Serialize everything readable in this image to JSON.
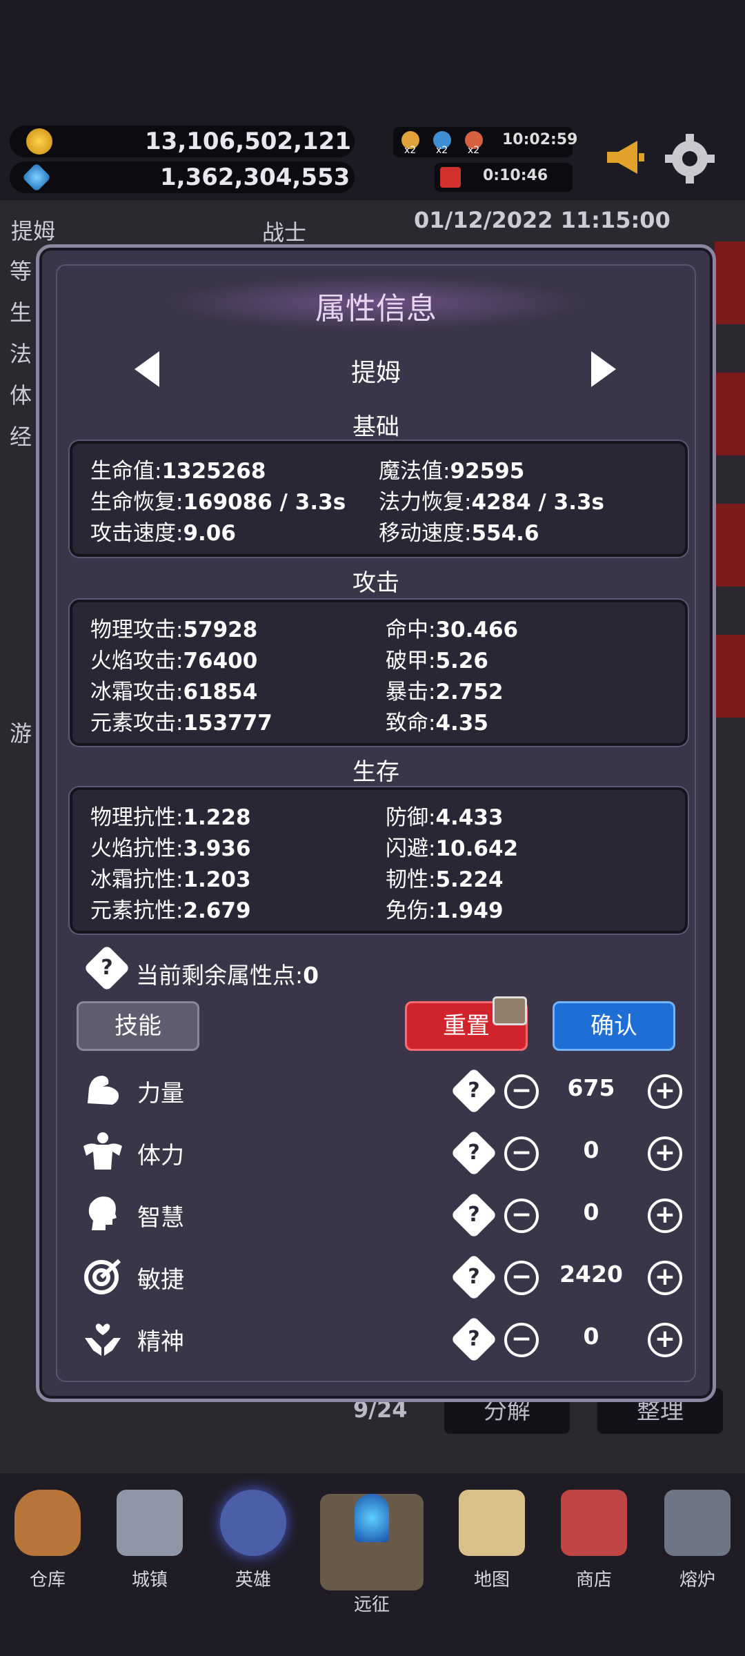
{
  "top": {
    "gold": "13,106,502,121",
    "gems": "1,362,304,553",
    "buff_multipliers": [
      "x2",
      "x2",
      "x2"
    ],
    "buff_timer": "10:02:59",
    "gift_timer": "0:10:46"
  },
  "background": {
    "hero_name": "提姆",
    "hero_class": "战士",
    "datetime": "01/12/2022 11:15:00",
    "side_labels": [
      "等",
      "生",
      "法",
      "体",
      "经",
      "游"
    ],
    "bag_count": "9/24",
    "decompose_label": "分解",
    "sort_label": "整理"
  },
  "modal": {
    "title": "属性信息",
    "hero_name": "提姆",
    "basic": {
      "label": "基础",
      "rows": [
        {
          "l_label": "生命值:",
          "l_val": "1325268",
          "r_label": "魔法值:",
          "r_val": "92595"
        },
        {
          "l_label": "生命恢复:",
          "l_val": "169086 / 3.3s",
          "r_label": "法力恢复:",
          "r_val": "4284 / 3.3s"
        },
        {
          "l_label": "攻击速度:",
          "l_val": "9.06",
          "r_label": "移动速度:",
          "r_val": "554.6"
        }
      ]
    },
    "attack": {
      "label": "攻击",
      "rows": [
        {
          "l_label": "物理攻击:",
          "l_val": "57928",
          "r_label": "命中:",
          "r_val": "30.466"
        },
        {
          "l_label": "火焰攻击:",
          "l_val": "76400",
          "r_label": "破甲:",
          "r_val": "5.26"
        },
        {
          "l_label": "冰霜攻击:",
          "l_val": "61854",
          "r_label": "暴击:",
          "r_val": "2.752"
        },
        {
          "l_label": "元素攻击:",
          "l_val": "153777",
          "r_label": "致命:",
          "r_val": "4.35"
        }
      ]
    },
    "survival": {
      "label": "生存",
      "rows": [
        {
          "l_label": "物理抗性:",
          "l_val": "1.228",
          "r_label": "防御:",
          "r_val": "4.433"
        },
        {
          "l_label": "火焰抗性:",
          "l_val": "3.936",
          "r_label": "闪避:",
          "r_val": "10.642"
        },
        {
          "l_label": "冰霜抗性:",
          "l_val": "1.203",
          "r_label": "韧性:",
          "r_val": "5.224"
        },
        {
          "l_label": "元素抗性:",
          "l_val": "2.679",
          "r_label": "免伤:",
          "r_val": "1.949"
        }
      ]
    },
    "remaining_points_label": "当前剩余属性点:",
    "remaining_points": "0",
    "skill_button": "技能",
    "reset_button": "重置",
    "confirm_button": "确认",
    "attributes": [
      {
        "name": "力量",
        "value": "675",
        "icon": "strength-icon"
      },
      {
        "name": "体力",
        "value": "0",
        "icon": "stamina-icon"
      },
      {
        "name": "智慧",
        "value": "0",
        "icon": "wisdom-icon"
      },
      {
        "name": "敏捷",
        "value": "2420",
        "icon": "agility-icon"
      },
      {
        "name": "精神",
        "value": "0",
        "icon": "spirit-icon"
      }
    ]
  },
  "nav": [
    {
      "label": "仓库",
      "icon": "bag-icon",
      "color": "#b8753a"
    },
    {
      "label": "城镇",
      "icon": "castle-icon",
      "color": "#8f96a8"
    },
    {
      "label": "英雄",
      "icon": "helmet-icon",
      "color": "#4a5fa8"
    },
    {
      "label": "远征",
      "icon": "portal-icon",
      "color": "#6a5a4a"
    },
    {
      "label": "地图",
      "icon": "map-icon",
      "color": "#d9c08a"
    },
    {
      "label": "商店",
      "icon": "shop-icon",
      "color": "#c04545"
    },
    {
      "label": "熔炉",
      "icon": "anvil-icon",
      "color": "#6e7585"
    }
  ],
  "colors": {
    "reset": "#d0232b",
    "confirm": "#1e6ed6",
    "skill": "#5f5c70"
  }
}
